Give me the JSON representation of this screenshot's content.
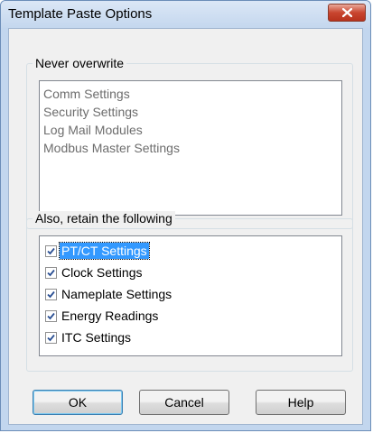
{
  "window": {
    "title": "Template Paste Options"
  },
  "never_overwrite": {
    "label": "Never overwrite",
    "items": [
      "Comm Settings",
      "Security Settings",
      "Log Mail Modules",
      "Modbus Master Settings"
    ]
  },
  "retain": {
    "label": "Also, retain the following",
    "items": [
      {
        "label": "PT/CT Settings",
        "checked": true,
        "selected": true
      },
      {
        "label": "Clock Settings",
        "checked": true,
        "selected": false
      },
      {
        "label": "Nameplate Settings",
        "checked": true,
        "selected": false
      },
      {
        "label": "Energy Readings",
        "checked": true,
        "selected": false
      },
      {
        "label": "ITC Settings",
        "checked": true,
        "selected": false
      }
    ]
  },
  "buttons": {
    "ok": "OK",
    "cancel": "Cancel",
    "help": "Help"
  },
  "colors": {
    "title_bg": "#c4d7ee",
    "close_red": "#c9452f",
    "selection": "#3399ff",
    "check": "#2a4f93"
  },
  "icons": {
    "close": "close-icon",
    "check": "checkmark-icon"
  }
}
